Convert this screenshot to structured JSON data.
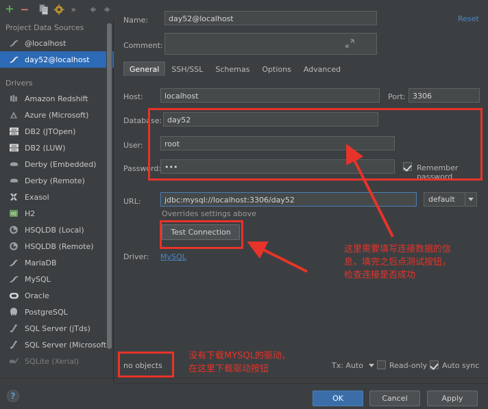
{
  "toolbar": {
    "buttons": [
      {
        "name": "add",
        "glyph": "+"
      },
      {
        "name": "remove",
        "glyph": "−"
      },
      {
        "name": "copy",
        "glyph": "⧉"
      },
      {
        "name": "properties",
        "glyph": "⚙"
      },
      {
        "name": "more",
        "glyph": "»"
      },
      {
        "name": "back",
        "glyph": "←"
      },
      {
        "name": "forward",
        "glyph": "→"
      }
    ]
  },
  "sidebar": {
    "project_group_title": "Project Data Sources",
    "project_items": [
      {
        "label": "@localhost",
        "icon": "mysql-icon",
        "selected": false
      },
      {
        "label": "day52@localhost",
        "icon": "mysql-icon",
        "selected": true
      }
    ],
    "drivers_group_title": "Drivers",
    "drivers": [
      {
        "label": "Amazon Redshift",
        "icon": "redshift-icon"
      },
      {
        "label": "Azure (Microsoft)",
        "icon": "azure-icon"
      },
      {
        "label": "DB2 (JTOpen)",
        "icon": "db2-icon"
      },
      {
        "label": "DB2 (LUW)",
        "icon": "db2-icon"
      },
      {
        "label": "Derby (Embedded)",
        "icon": "derby-icon"
      },
      {
        "label": "Derby (Remote)",
        "icon": "derby-icon"
      },
      {
        "label": "Exasol",
        "icon": "exasol-icon"
      },
      {
        "label": "H2",
        "icon": "h2-icon"
      },
      {
        "label": "HSQLDB (Local)",
        "icon": "hsqldb-icon"
      },
      {
        "label": "HSQLDB (Remote)",
        "icon": "hsqldb-icon"
      },
      {
        "label": "MariaDB",
        "icon": "mariadb-icon"
      },
      {
        "label": "MySQL",
        "icon": "mysql-icon"
      },
      {
        "label": "Oracle",
        "icon": "oracle-icon"
      },
      {
        "label": "PostgreSQL",
        "icon": "postgresql-icon"
      },
      {
        "label": "SQL Server (jTds)",
        "icon": "sqlserver-icon"
      },
      {
        "label": "SQL Server (Microsoft)",
        "icon": "sqlserver-icon"
      },
      {
        "label": "SQLite (Xerial)",
        "icon": "sqlite-icon"
      }
    ],
    "help_glyph": "?"
  },
  "form": {
    "name_label": "Name:",
    "name_value": "day52@localhost",
    "reset_label": "Reset",
    "comment_label": "Comment:",
    "comment_value": "",
    "tabs": [
      {
        "label": "General",
        "active": true
      },
      {
        "label": "SSH/SSL",
        "active": false
      },
      {
        "label": "Schemas",
        "active": false
      },
      {
        "label": "Options",
        "active": false
      },
      {
        "label": "Advanced",
        "active": false
      }
    ],
    "host_label": "Host:",
    "host_value": "localhost",
    "port_label": "Port:",
    "port_value": "3306",
    "database_label": "Database:",
    "database_value": "day52",
    "user_label": "User:",
    "user_value": "root",
    "password_label": "Password:",
    "password_value": "•••",
    "remember_password_label": "Remember password",
    "remember_password_checked": true,
    "url_label": "URL:",
    "url_value": "jdbc:mysql://localhost:3306/day52",
    "url_hint": "Overrides settings above",
    "url_scheme_value": "default",
    "test_connection_label": "Test Connection",
    "driver_label": "Driver:",
    "driver_value": "MySQL"
  },
  "status_bar": {
    "no_objects_label": "no objects",
    "tx_label": "Tx: Auto",
    "read_only_label": "Read-only",
    "read_only_checked": false,
    "auto_sync_label": "Auto sync",
    "auto_sync_checked": true
  },
  "footer": {
    "ok_label": "OK",
    "cancel_label": "Cancel",
    "apply_label": "Apply"
  },
  "annotations": {
    "note_connection": "这里需要填写连接数据的信\n息，填完之后点测试按钮，\n检查连接是否成功",
    "note_driver": "没有下载MYSQL的驱动，\n在这里下载驱动按钮",
    "color": "#e8332a"
  }
}
